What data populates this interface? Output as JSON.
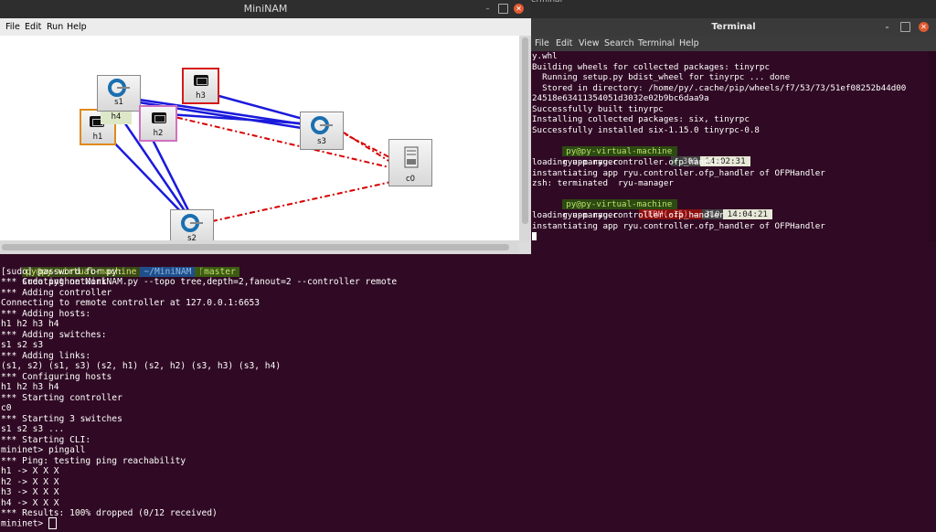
{
  "desktop": {
    "topbar_label": "erminal"
  },
  "mininam": {
    "title": "MiniNAM",
    "menu": [
      "File",
      "Edit",
      "Run",
      "Help"
    ],
    "nodes": [
      {
        "id": "s1",
        "label": "s1",
        "type": "switch"
      },
      {
        "id": "h4",
        "label": "h4",
        "type": "host"
      },
      {
        "id": "h1",
        "label": "h1",
        "type": "host"
      },
      {
        "id": "h2",
        "label": "h2",
        "type": "host"
      },
      {
        "id": "h3",
        "label": "h3",
        "type": "host"
      },
      {
        "id": "s3",
        "label": "s3",
        "type": "switch"
      },
      {
        "id": "s2",
        "label": "s2",
        "type": "switch"
      },
      {
        "id": "c0",
        "label": "c0",
        "type": "controller"
      }
    ],
    "colors": {
      "link": "#1a1adc",
      "controller_link": "#d80000",
      "h1_border": "#e08a1a",
      "h2_border": "#d070c0",
      "h3_border": "#d81818"
    }
  },
  "terminal": {
    "title": "Terminal",
    "menu": [
      "File",
      "Edit",
      "View",
      "Search",
      "Terminal",
      "Help"
    ],
    "lines": [
      "y.whl",
      "Building wheels for collected packages: tinyrpc",
      "  Running setup.py bdist_wheel for tinyrpc ... done",
      "  Stored in directory: /home/py/.cache/pip/wheels/f7/53/73/51ef08252b44d00",
      "24518e63411354051d3032e02b9bc6daa9a",
      "Successfully built tinyrpc",
      "Installing collected packages: six, tinyrpc",
      "Successfully installed six-1.15.0 tinyrpc-0.8"
    ],
    "prompt1": {
      "user": "py@py-virtual-machine",
      "command": "ryu-manager",
      "status": "✓",
      "num": "309",
      "time": "14:02:31"
    },
    "lines2": [
      "loading app ryu.controller.ofp_handler",
      "instantiating app ryu.controller.ofp_handler of OFPHandler",
      "zsh: terminated  ryu-manager"
    ],
    "prompt2": {
      "user": "py@py-virtual-machine",
      "command": "ryu-manager",
      "status": "TERM(-15) ↵",
      "num": "310",
      "time": "14:04:21"
    },
    "lines3": [
      "loading app ryu.controller.ofp_handler",
      "instantiating app ryu.controller.ofp_handler of OFPHandler"
    ]
  },
  "bgterminal": {
    "prompt": {
      "user": "py@py-virtual-machine",
      "dir": "~/MiniNAM",
      "git": "master",
      "command": "sudo python MiniNAM.py --topo tree,depth=2,fanout=2 --controller remote"
    },
    "lines": [
      "[sudo] password for py:",
      "*** Creating network",
      "*** Adding controller",
      "Connecting to remote controller at 127.0.0.1:6653",
      "*** Adding hosts:",
      "h1 h2 h3 h4",
      "*** Adding switches:",
      "s1 s2 s3",
      "*** Adding links:",
      "(s1, s2) (s1, s3) (s2, h1) (s2, h2) (s3, h3) (s3, h4)",
      "*** Configuring hosts",
      "h1 h2 h3 h4",
      "*** Starting controller",
      "c0",
      "*** Starting 3 switches",
      "s1 s2 s3 ...",
      "*** Starting CLI:",
      "mininet> pingall",
      "*** Ping: testing ping reachability",
      "h1 -> X X X",
      "h2 -> X X X",
      "h3 -> X X X",
      "h4 -> X X X",
      "*** Results: 100% dropped (0/12 received)"
    ],
    "final_prompt": "mininet> "
  }
}
